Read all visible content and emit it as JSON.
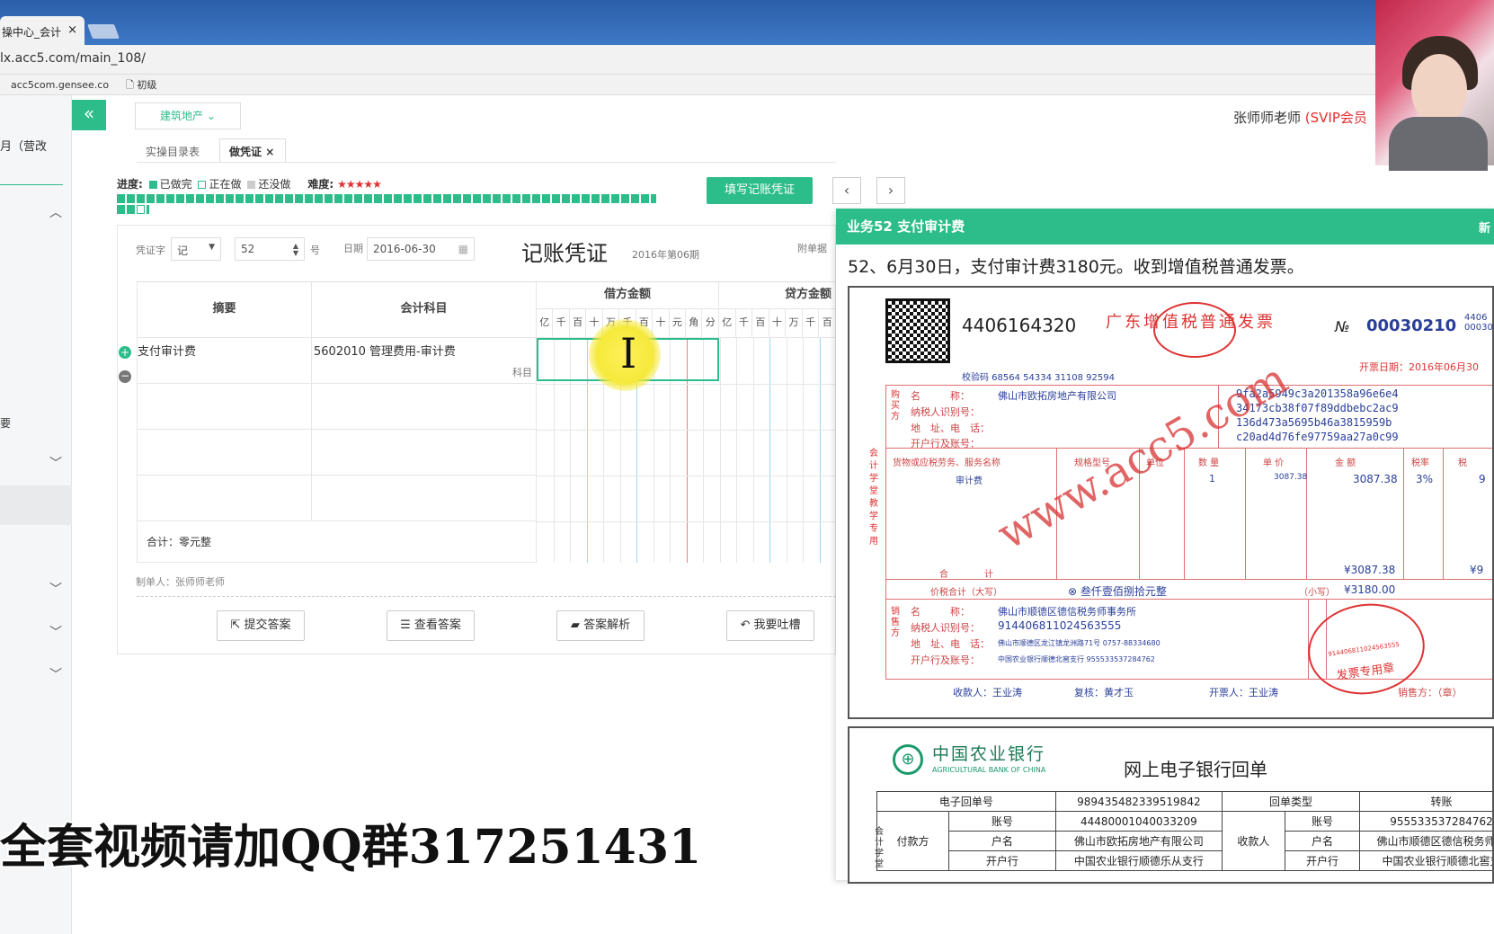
{
  "browser": {
    "tab_title": "操中心_会计",
    "tab_close": "×",
    "url": "lx.acc5.com/main_108/",
    "bookmarks": [
      "acc5com.gensee.co",
      "初级"
    ]
  },
  "sidebar": {
    "top_label": "月（营改",
    "mid_label": "要"
  },
  "header": {
    "collapse_icon": "«",
    "project_dropdown": "建筑地产",
    "teacher_name": "张师师老师",
    "teacher_badge": "(SVIP会员"
  },
  "subtabs": {
    "catalog": "实操目录表",
    "voucher": "做凭证",
    "close": "×"
  },
  "progress": {
    "label": "进度:",
    "done": "已做完",
    "doing": "正在做",
    "todo": "还没做",
    "difficulty_label": "难度:",
    "difficulty_stars": "★★★★★",
    "total_items": 52,
    "completed_items": 51
  },
  "toolbar": {
    "fill_button": "填写记账凭证",
    "prev": "‹",
    "next": "›"
  },
  "voucher": {
    "type_label": "凭证字",
    "type_value": "记",
    "number_value": "52",
    "number_suffix": "号",
    "date_label": "日期",
    "date_value": "2016-06-30",
    "title": "记账凭证",
    "period": "2016年第06期",
    "attachments_label": "附单据",
    "col_summary": "摘要",
    "col_account": "会计科目",
    "col_debit": "借方金额",
    "col_credit": "贷方金额",
    "debit_digits": [
      "亿",
      "千",
      "百",
      "十",
      "万",
      "千",
      "百",
      "十",
      "元",
      "角",
      "分"
    ],
    "credit_digits": [
      "亿",
      "千",
      "百",
      "十",
      "万",
      "千",
      "百"
    ],
    "row1_summary": "支付审计费",
    "row1_account": "5602010 管理费用-审计费",
    "row1_account_hint": "科目",
    "total": "合计：零元整",
    "maker": "制单人：张师师老师"
  },
  "actions": {
    "submit": "提交答案",
    "view": "查看答案",
    "analysis": "答案解析",
    "complain": "我要吐槽"
  },
  "panel": {
    "title": "业务52 支付审计费",
    "new_label": "新",
    "description": "52、6月30日，支付审计费3180元。收到增值税普通发票。"
  },
  "invoice": {
    "code": "4406164320",
    "title": "广东增值税普通发票",
    "no_label": "№",
    "number": "00030210",
    "number_right_top": "4406",
    "number_right_bottom": "00030",
    "check_code": "校验码 68564 54334 31108 92594",
    "issue_date": "开票日期：2016年06月30",
    "buyer_name_label": "名　　　称：",
    "buyer_name": "佛山市欧拓房地产有限公司",
    "buyer_tax_label": "纳税人识别号：",
    "buyer_addr_label": "地　址、电　话：",
    "buyer_bank_label": "开户行及账号：",
    "cipher": [
      "9fa2a5949c3a201358a96e6e4",
      "34173cb38f07f89ddbebc2ac9",
      "136d473a5695b46a3815959b",
      "c20ad4d76fe97759aa27a0c99"
    ],
    "col_item": "货物或应税劳务、服务名称",
    "col_spec": "规格型号",
    "col_unit": "单位",
    "col_qty": "数 量",
    "col_price": "单 价",
    "col_amount": "金 额",
    "col_rate": "税率",
    "col_tax": "税",
    "item_name": "审计费",
    "item_qty": "1",
    "item_price": "3087.38",
    "item_amount": "3087.38",
    "item_rate": "3%",
    "item_tax": "9",
    "subtotal_label": "合　　　　计",
    "subtotal": "¥3087.38",
    "subtotal_tax": "¥9",
    "total_label": "价税合计（大写）",
    "total_words": "⊗ 叁仟壹佰捌拾元整",
    "total_small_label": "（小写）",
    "total_small": "¥3180.00",
    "seller_name": "佛山市顺德区德信税务师事务所",
    "seller_tax": "914406811024563555",
    "seller_addr": "佛山市顺德区龙江镇龙洲路71号 0757-88334680",
    "seller_bank": "中国农业银行顺德北窖支行 955533537284762",
    "payee": "收款人：王业涛",
    "reviewer": "复核：黄才玉",
    "drawer": "开票人：王业涛",
    "seller_side": "销售方：（章）",
    "side_buyer": "购买方",
    "side_seller": "销售方",
    "side_vertical": "会计学堂教学专用",
    "seal_text": "发票专用章",
    "seal_number": "914406811024563555",
    "watermark": "www.acc5.com"
  },
  "bank": {
    "name_cn": "中国农业银行",
    "name_en": "AGRICULTURAL BANK OF CHINA",
    "title": "网上电子银行回单",
    "receipt_no_label": "电子回单号",
    "receipt_no": "989435482339519842",
    "receipt_type_label": "回单类型",
    "receipt_type": "转账",
    "payer_label": "付款方",
    "payee_label": "收款人",
    "account_label": "账号",
    "name_label": "户名",
    "bank_label": "开户行",
    "payer_account": "44480001040033209",
    "payer_name": "佛山市欧拓房地产有限公司",
    "payer_bank": "中国农业银行顺德乐从支行",
    "payee_account": "955533537284762",
    "payee_name": "佛山市顺德区德信税务师事",
    "payee_bank": "中国农业银行顺德北窖支",
    "side_vertical": "会计学堂"
  },
  "overlay": {
    "subtitle": "全套视频请加QQ群317251431"
  },
  "colors": {
    "accent": "#2dbd8a",
    "invoice_red": "#cc3333",
    "invoice_blue": "#2a3f99",
    "chrome_blue": "#3f78c6"
  }
}
